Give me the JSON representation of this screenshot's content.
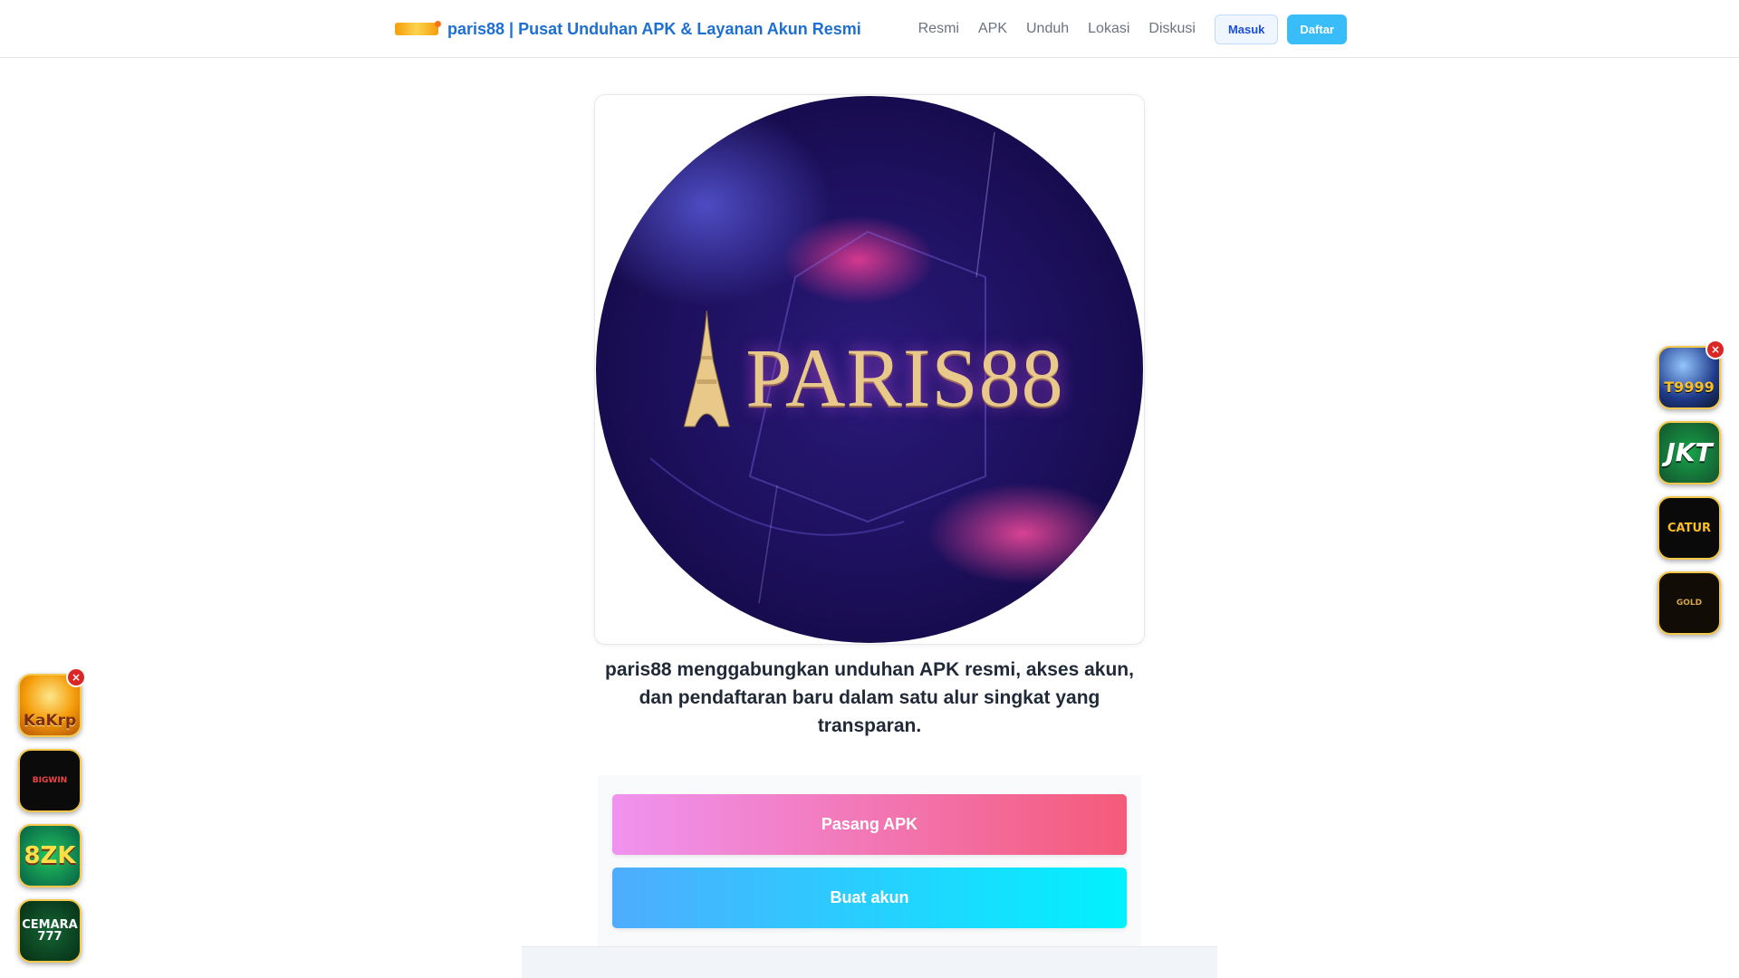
{
  "header": {
    "title": "paris88 | Pusat Unduhan APK & Layanan Akun Resmi",
    "nav": [
      "Resmi",
      "APK",
      "Unduh",
      "Lokasi",
      "Diskusi"
    ],
    "login_label": "Masuk",
    "register_label": "Daftar"
  },
  "hero": {
    "brand_text": "PARIS88"
  },
  "intro": {
    "text": "paris88 menggabungkan unduhan APK resmi, akses akun, dan pendaftaran baru dalam satu alur singkat yang transparan."
  },
  "cta": {
    "install_label": "Pasang APK",
    "account_label": "Buat akun"
  },
  "floating": {
    "close_label": "×",
    "left": [
      "KaKrp",
      "BIGWIN",
      "8ZK",
      "CEMARA 777"
    ],
    "right": [
      "T9999",
      "JKT",
      "CATUR",
      "GOLD"
    ]
  },
  "colors": {
    "brand_blue": "#1d6fd1",
    "apk_gradient": [
      "#f093f0",
      "#f45b7a"
    ],
    "account_gradient": [
      "#4facfe",
      "#00f2fe"
    ],
    "daftar": "#38bdf8",
    "close": "#dc2626"
  }
}
